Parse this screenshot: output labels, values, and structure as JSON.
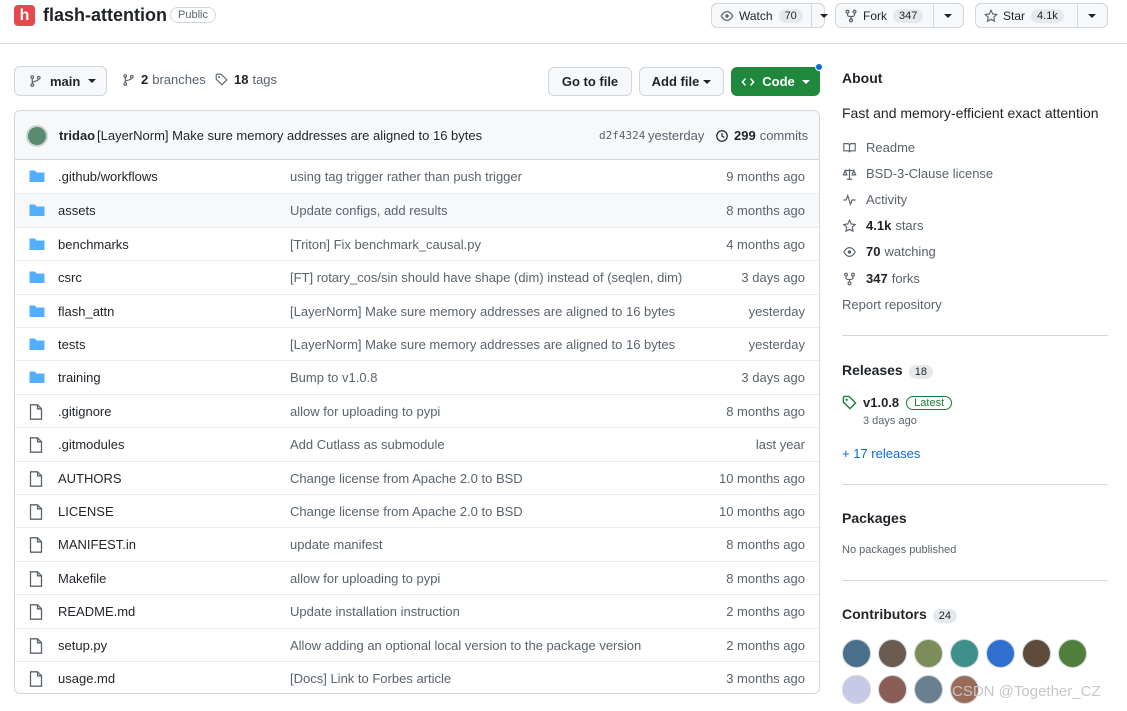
{
  "repo": {
    "name": "flash-attention",
    "visibility": "Public",
    "logo_letter": "h"
  },
  "header_buttons": {
    "watch": {
      "label": "Watch",
      "count": "70"
    },
    "fork": {
      "label": "Fork",
      "count": "347"
    },
    "star": {
      "label": "Star",
      "count": "4.1k"
    }
  },
  "toolbar": {
    "branch": "main",
    "branches_count": "2",
    "branches_label": "branches",
    "tags_count": "18",
    "tags_label": "tags",
    "go_to_file": "Go to file",
    "add_file": "Add file",
    "code": "Code"
  },
  "latest_commit": {
    "author": "tridao",
    "message": "[LayerNorm] Make sure memory addresses are aligned to 16 bytes",
    "sha": "d2f4324",
    "time": "yesterday",
    "commit_count": "299",
    "commits_label": "commits"
  },
  "files": [
    {
      "type": "folder",
      "name": ".github/workflows",
      "message": "using tag trigger rather than push trigger",
      "date": "9 months ago"
    },
    {
      "type": "folder",
      "name": "assets",
      "message": "Update configs, add results",
      "date": "8 months ago"
    },
    {
      "type": "folder",
      "name": "benchmarks",
      "message": "[Triton] Fix benchmark_causal.py",
      "date": "4 months ago"
    },
    {
      "type": "folder",
      "name": "csrc",
      "message": "[FT] rotary_cos/sin should have shape (dim) instead of (seqlen, dim)",
      "date": "3 days ago"
    },
    {
      "type": "folder",
      "name": "flash_attn",
      "message": "[LayerNorm] Make sure memory addresses are aligned to 16 bytes",
      "date": "yesterday"
    },
    {
      "type": "folder",
      "name": "tests",
      "message": "[LayerNorm] Make sure memory addresses are aligned to 16 bytes",
      "date": "yesterday"
    },
    {
      "type": "folder",
      "name": "training",
      "message": "Bump to v1.0.8",
      "date": "3 days ago"
    },
    {
      "type": "file",
      "name": ".gitignore",
      "message": "allow for uploading to pypi",
      "date": "8 months ago"
    },
    {
      "type": "file",
      "name": ".gitmodules",
      "message": "Add Cutlass as submodule",
      "date": "last year"
    },
    {
      "type": "file",
      "name": "AUTHORS",
      "message": "Change license from Apache 2.0 to BSD",
      "date": "10 months ago"
    },
    {
      "type": "file",
      "name": "LICENSE",
      "message": "Change license from Apache 2.0 to BSD",
      "date": "10 months ago"
    },
    {
      "type": "file",
      "name": "MANIFEST.in",
      "message": "update manifest",
      "date": "8 months ago"
    },
    {
      "type": "file",
      "name": "Makefile",
      "message": "allow for uploading to pypi",
      "date": "8 months ago"
    },
    {
      "type": "file",
      "name": "README.md",
      "message": "Update installation instruction",
      "date": "2 months ago"
    },
    {
      "type": "file",
      "name": "setup.py",
      "message": "Allow adding an optional local version to the package version",
      "date": "2 months ago"
    },
    {
      "type": "file",
      "name": "usage.md",
      "message": "[Docs] Link to Forbes article",
      "date": "3 months ago"
    }
  ],
  "about": {
    "heading": "About",
    "description": "Fast and memory-efficient exact attention",
    "readme": "Readme",
    "license": "BSD-3-Clause license",
    "activity": "Activity",
    "stars_count": "4.1k",
    "stars_label": "stars",
    "watching_count": "70",
    "watching_label": "watching",
    "forks_count": "347",
    "forks_label": "forks",
    "report": "Report repository"
  },
  "releases": {
    "heading": "Releases",
    "count": "18",
    "latest_tag": "v1.0.8",
    "latest_badge": "Latest",
    "latest_date": "3 days ago",
    "more_link": "+ 17 releases"
  },
  "packages": {
    "heading": "Packages",
    "empty_text": "No packages published"
  },
  "contributors": {
    "heading": "Contributors",
    "count": "24",
    "avatar_colors": [
      "#4a6f8a",
      "#6b5a4e",
      "#7c8c5a",
      "#3f8f8a",
      "#2f6fd0",
      "#5e4b3c",
      "#4f7f3a",
      "#c7c9e6",
      "#8a5d56",
      "#6a7f8f",
      "#9b6b5a"
    ]
  },
  "colors": {
    "accent_green": "#1f883d",
    "link_blue": "#0969da",
    "folder_blue": "#54aeff",
    "logo_red": "#e5484d"
  },
  "watermark": "CSDN @Together_CZ"
}
